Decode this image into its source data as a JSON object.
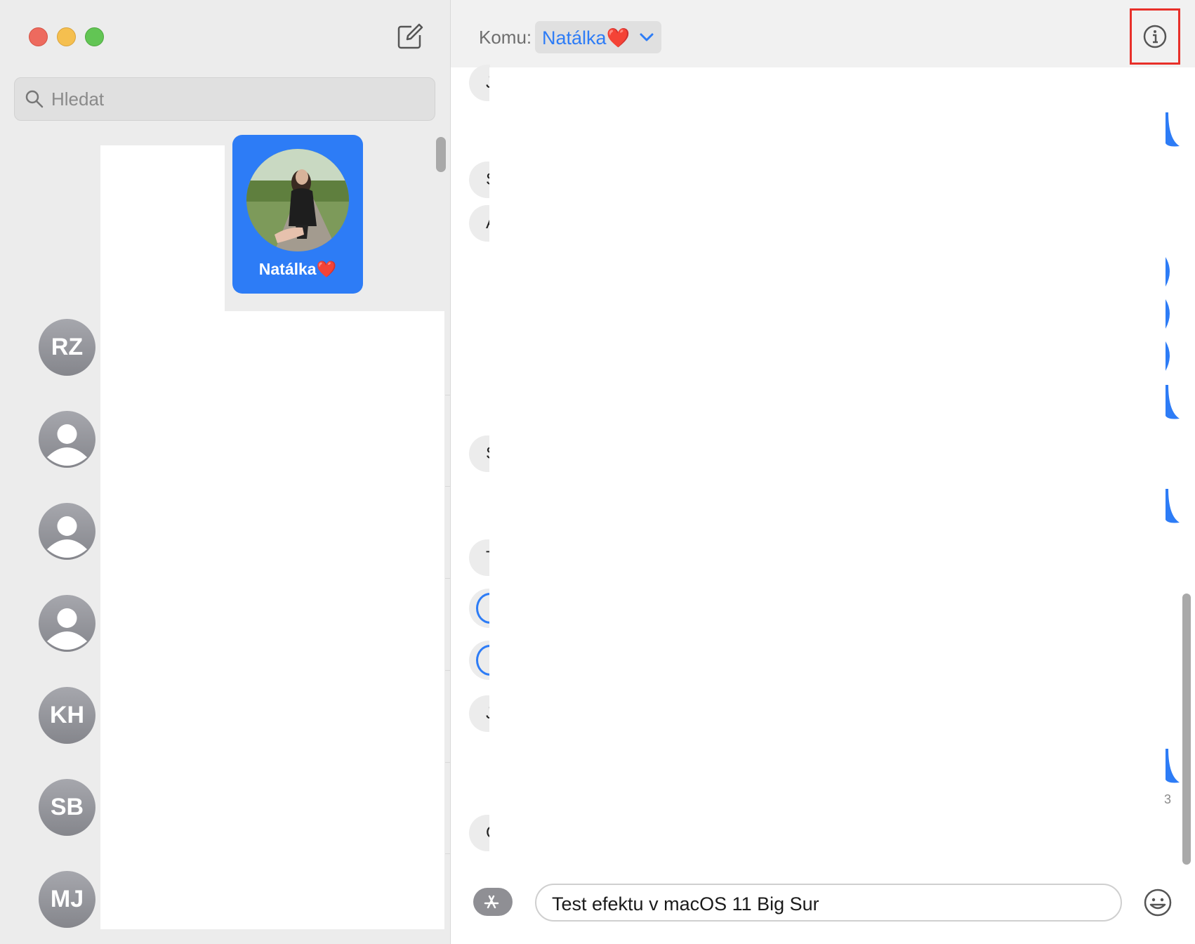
{
  "sidebar": {
    "search_placeholder": "Hledat",
    "pinned": {
      "name": "Natálka❤️"
    },
    "conversations": [
      {
        "initials": "RZ"
      },
      {
        "initials": ""
      },
      {
        "initials": ""
      },
      {
        "initials": ""
      },
      {
        "initials": "KH"
      },
      {
        "initials": "SB"
      },
      {
        "initials": "MJ"
      }
    ]
  },
  "header": {
    "to_label": "Komu:",
    "recipient": "Natálka❤️"
  },
  "chat": {
    "incoming_fragments": [
      "J",
      "S",
      "A",
      "S",
      "T",
      "J",
      "C"
    ],
    "timestamp_fragment": "3"
  },
  "composer": {
    "text": "Test efektu v macOS 11 Big Sur"
  },
  "colors": {
    "accent": "#2d7cf6",
    "highlight": "#e8302a"
  }
}
